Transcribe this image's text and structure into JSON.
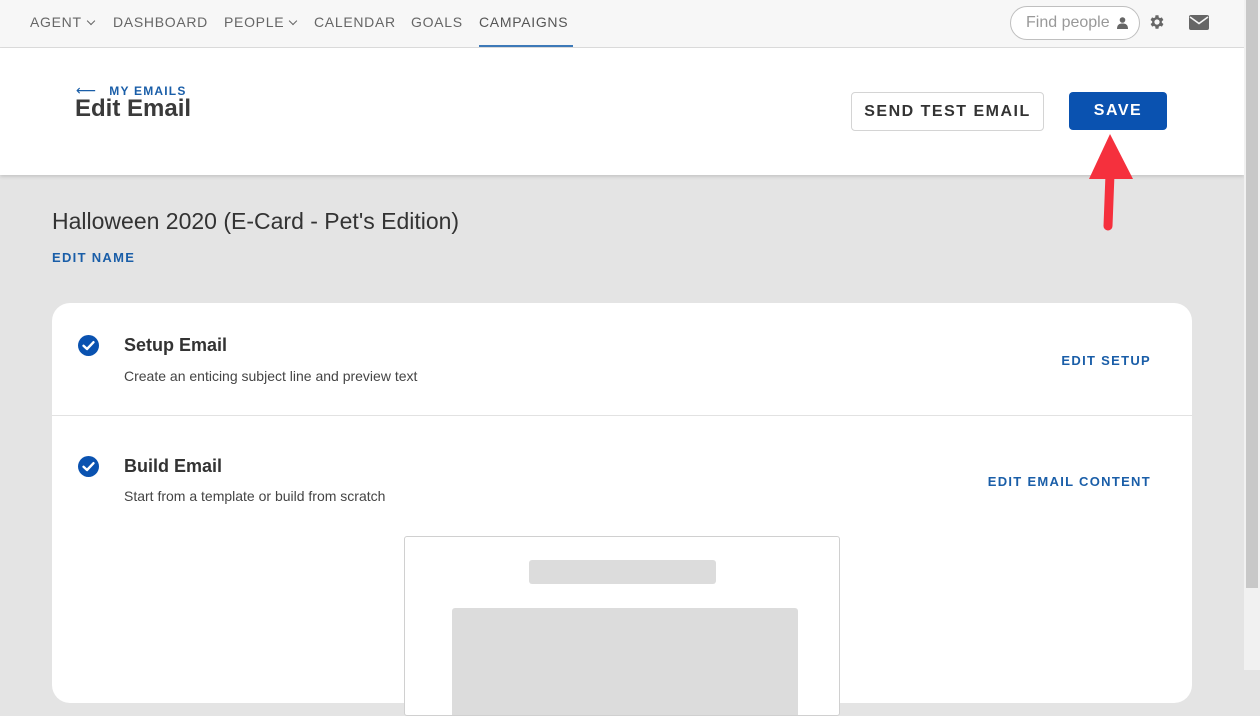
{
  "nav": {
    "items": [
      {
        "label": "AGENT",
        "dropdown": true
      },
      {
        "label": "DASHBOARD",
        "dropdown": false
      },
      {
        "label": "PEOPLE",
        "dropdown": true
      },
      {
        "label": "CALENDAR",
        "dropdown": false
      },
      {
        "label": "GOALS",
        "dropdown": false
      },
      {
        "label": "CAMPAIGNS",
        "dropdown": false,
        "active": true
      }
    ],
    "search_placeholder": "Find people",
    "icons": [
      "person-icon",
      "gear-icon",
      "mail-icon"
    ]
  },
  "header": {
    "back_label": "MY EMAILS",
    "title": "Edit Email",
    "send_test_label": "SEND TEST EMAIL",
    "save_label": "SAVE"
  },
  "email": {
    "name": "Halloween 2020 (E-Card - Pet's Edition)",
    "edit_name_label": "EDIT NAME"
  },
  "steps": [
    {
      "title": "Setup Email",
      "description": "Create an enticing subject line and preview text",
      "action": "EDIT SETUP",
      "completed": true
    },
    {
      "title": "Build Email",
      "description": "Start from a template or build from scratch",
      "action": "EDIT EMAIL CONTENT",
      "completed": true
    }
  ],
  "colors": {
    "primary": "#0a52b0",
    "link": "#1a5ea8",
    "annotation_arrow": "#f5303d"
  }
}
